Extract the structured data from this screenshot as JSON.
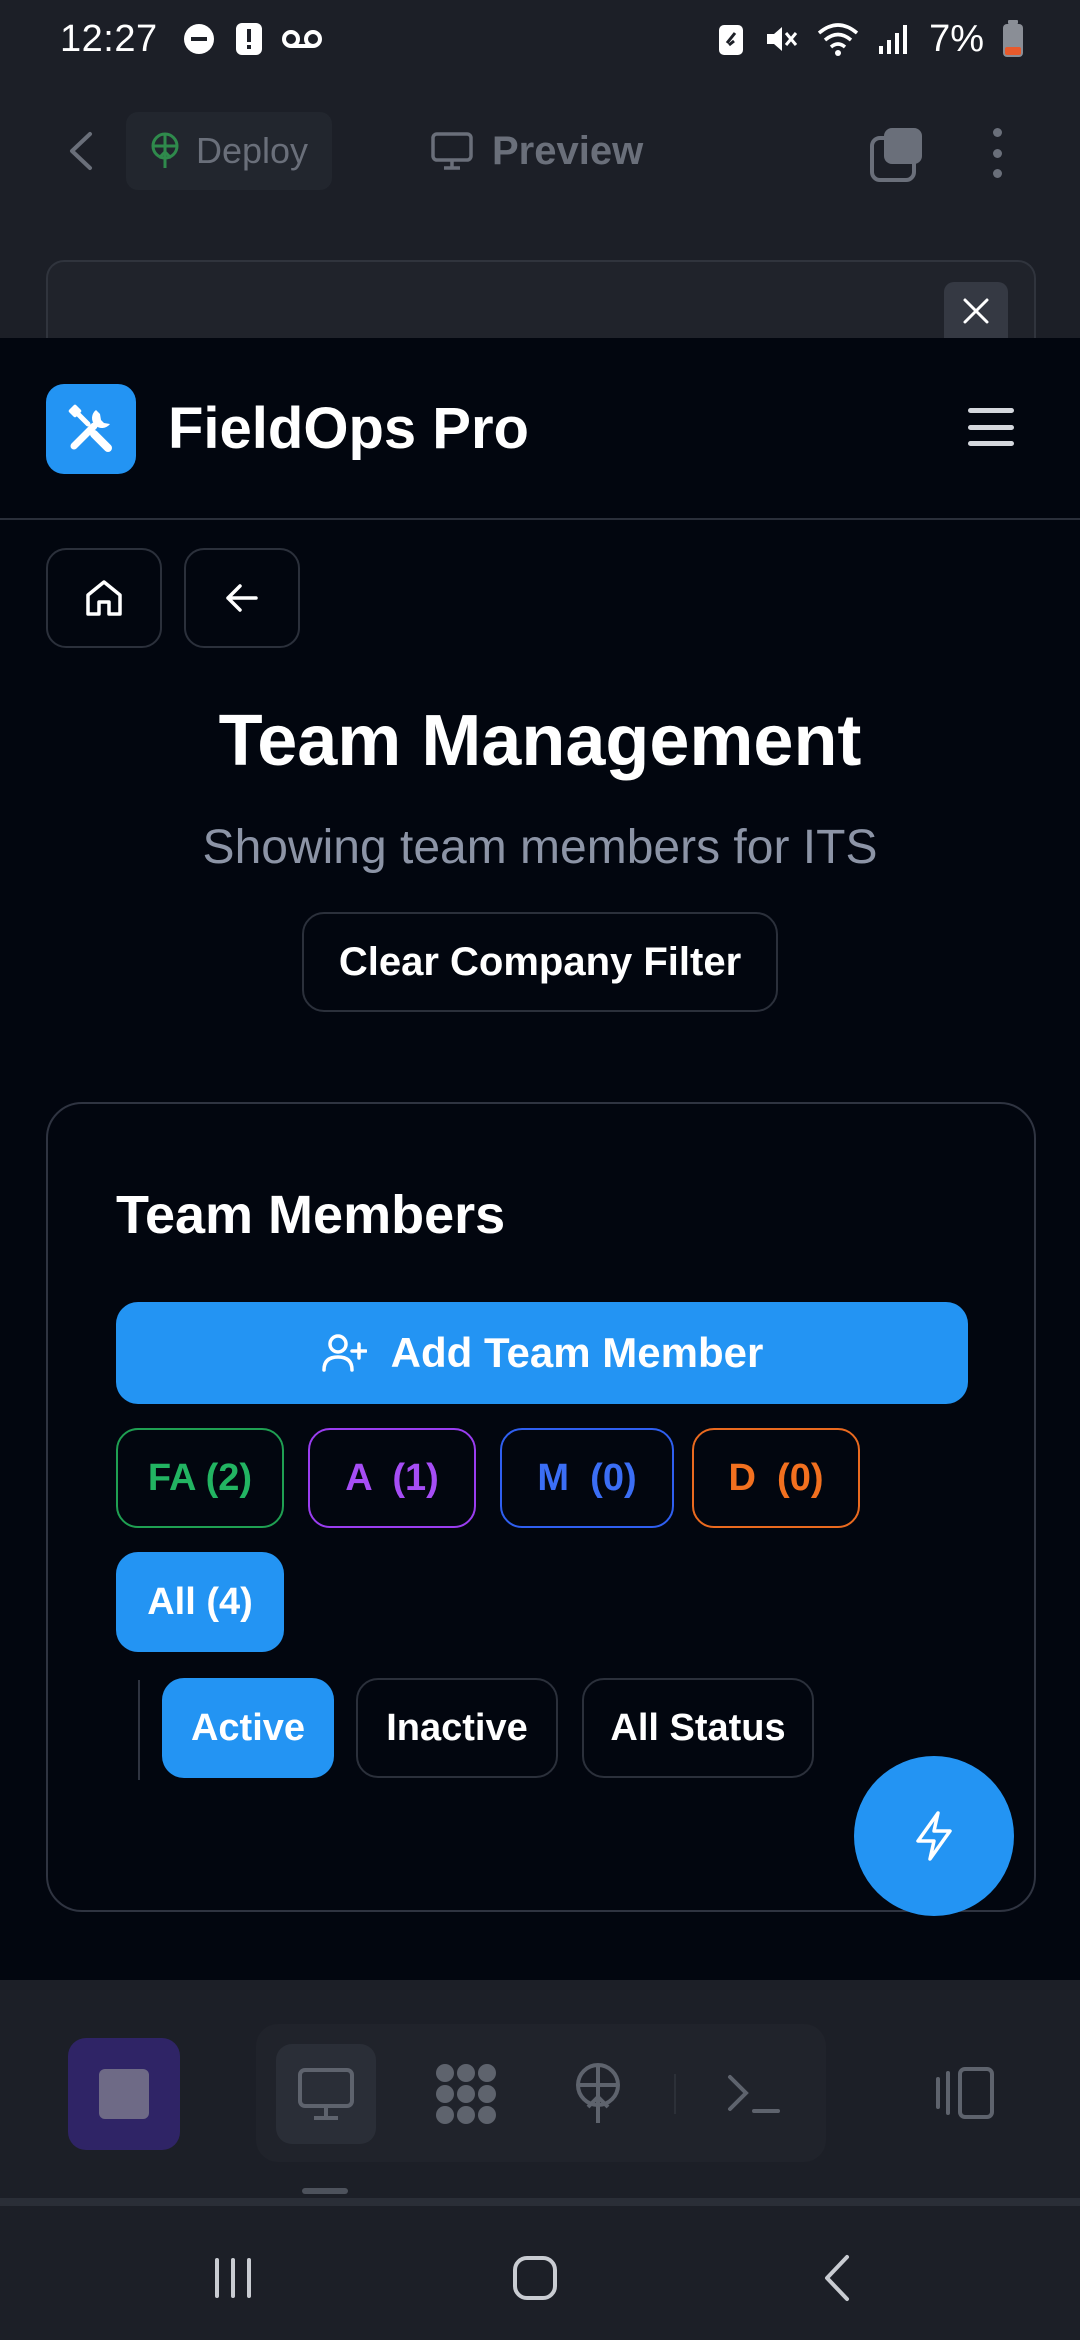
{
  "status_bar": {
    "time": "12:27",
    "battery": "7%"
  },
  "browser_toolbar": {
    "deploy_label": "Deploy",
    "preview_label": "Preview"
  },
  "app": {
    "title": "FieldOps Pro",
    "page_title": "Team Management",
    "subtitle": "Showing team members for ITS",
    "clear_filter_label": "Clear Company Filter",
    "card": {
      "title": "Team Members",
      "add_button_label": "Add Team Member",
      "role_filters": [
        {
          "label": "FA (2)",
          "color": "#22b462"
        },
        {
          "label": "A  (1)",
          "color": "#a64df5"
        },
        {
          "label": "M  (0)",
          "color": "#3b6ef5"
        },
        {
          "label": "D  (0)",
          "color": "#f2701f"
        },
        {
          "label": "All (4)",
          "selected": true
        }
      ],
      "status_filters": [
        {
          "label": "Active",
          "selected": true
        },
        {
          "label": "Inactive",
          "selected": false
        },
        {
          "label": "All Status",
          "selected": false
        }
      ]
    }
  },
  "colors": {
    "accent": "#2394f3",
    "app_background": "#02060f",
    "chrome_background": "#1c1f27"
  }
}
